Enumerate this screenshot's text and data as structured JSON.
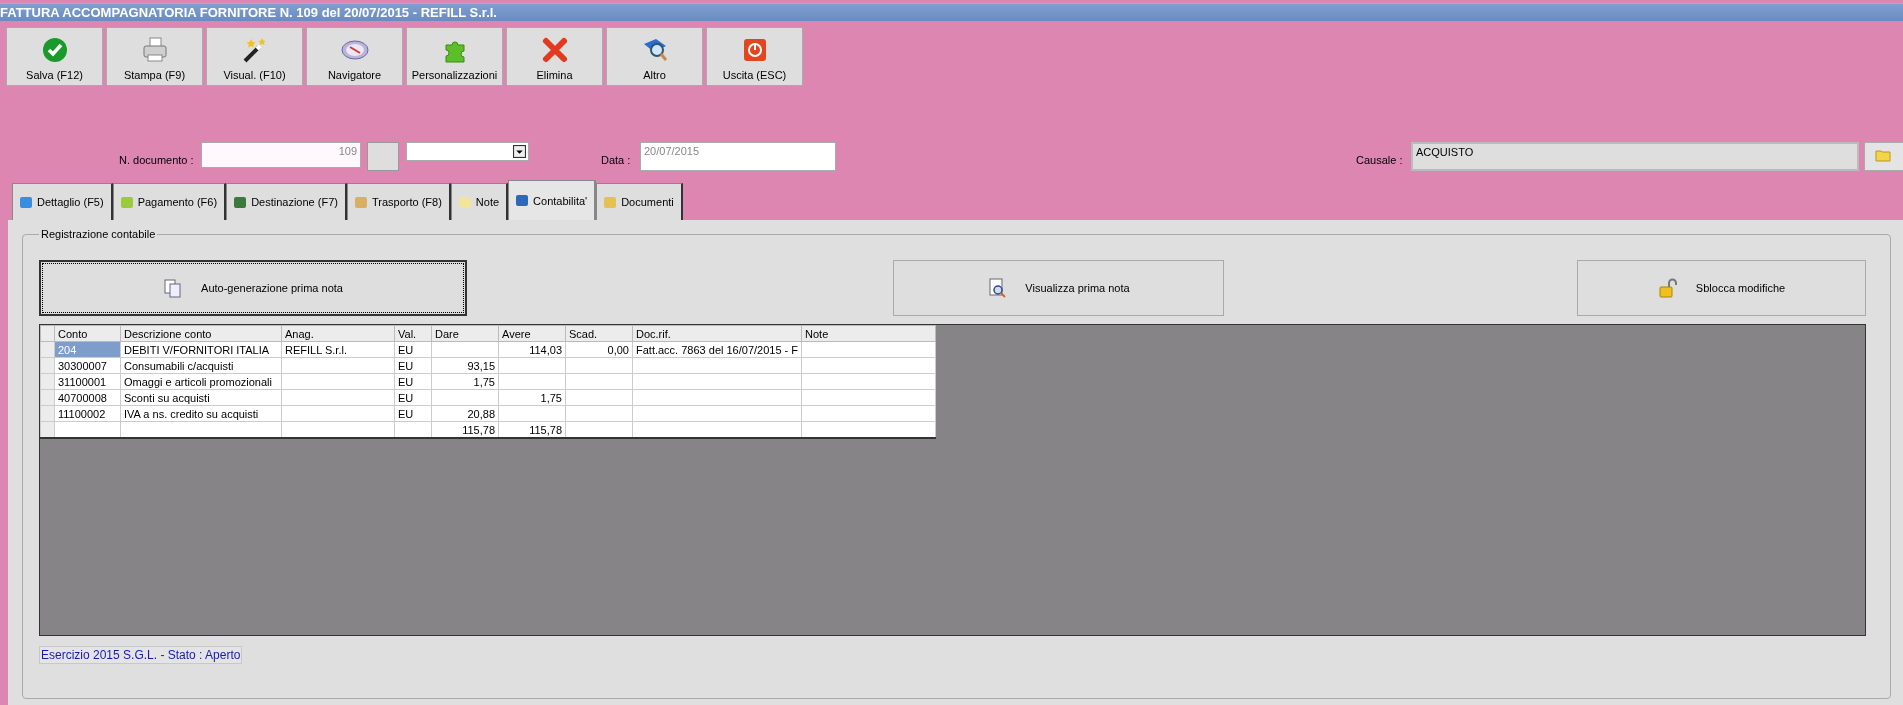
{
  "window": {
    "title": "FATTURA ACCOMPAGNATORIA FORNITORE N. 109 del 20/07/2015 - REFILL S.r.l."
  },
  "toolbar": [
    "Salva (F12)",
    "Stampa (F9)",
    "Visual. (F10)",
    "Navigatore",
    "Personalizzazioni",
    "Elimina",
    "Altro",
    "Uscita (ESC)"
  ],
  "form": {
    "numero_label": "N. documento :",
    "numero": "109",
    "data_label": "Data :",
    "data": "20/07/2015",
    "causale_label": "Causale :",
    "causale": "ACQUISTO"
  },
  "tabs": [
    {
      "label": "Dettaglio (F5)",
      "selected": false
    },
    {
      "label": "Pagamento (F6)",
      "selected": false
    },
    {
      "label": "Destinazione (F7)",
      "selected": false
    },
    {
      "label": "Trasporto (F8)",
      "selected": false
    },
    {
      "label": "Note",
      "selected": false
    },
    {
      "label": "Contabilita'",
      "selected": true
    },
    {
      "label": "Documenti",
      "selected": false
    }
  ],
  "group_title": "Registrazione contabile",
  "actions": [
    {
      "label": "Auto-generazione prima nota",
      "focused": true
    },
    {
      "label": "Visualizza prima nota",
      "focused": false
    },
    {
      "label": "Sblocca modifiche",
      "focused": false
    }
  ],
  "table": {
    "columns": [
      "Conto",
      "Descrizione conto",
      "Anag.",
      "Val.",
      "Dare",
      "Avere",
      "Scad.",
      "Doc.rif.",
      "Note"
    ],
    "rows": [
      {
        "conto": "204",
        "descrizione": "DEBITI V/FORNITORI ITALIA",
        "anag": "REFILL S.r.l.",
        "val": "EU",
        "avere": "114,03",
        "scad": "0,00",
        "doc_rif": "Fatt.acc. 7863 del 16/07/2015 - F",
        "selected": true
      },
      {
        "conto": "30300007",
        "descrizione": "Consumabili c/acquisti",
        "val": "EU",
        "dare": "93,15",
        "selected": false
      },
      {
        "conto": "31100001",
        "descrizione": "Omaggi e articoli promozionali",
        "val": "EU",
        "dare": "1,75",
        "selected": false
      },
      {
        "conto": "40700008",
        "descrizione": "Sconti su acquisti",
        "val": "EU",
        "avere": "1,75",
        "selected": false
      },
      {
        "conto": "11100002",
        "descrizione": "IVA a ns. credito su acquisti",
        "val": "EU",
        "dare": "20,88",
        "selected": false
      },
      {
        "dare": "115,78",
        "avere": "115,78",
        "selected": false
      }
    ]
  },
  "status": "Esercizio 2015 S.G.L. - Stato : Aperto"
}
